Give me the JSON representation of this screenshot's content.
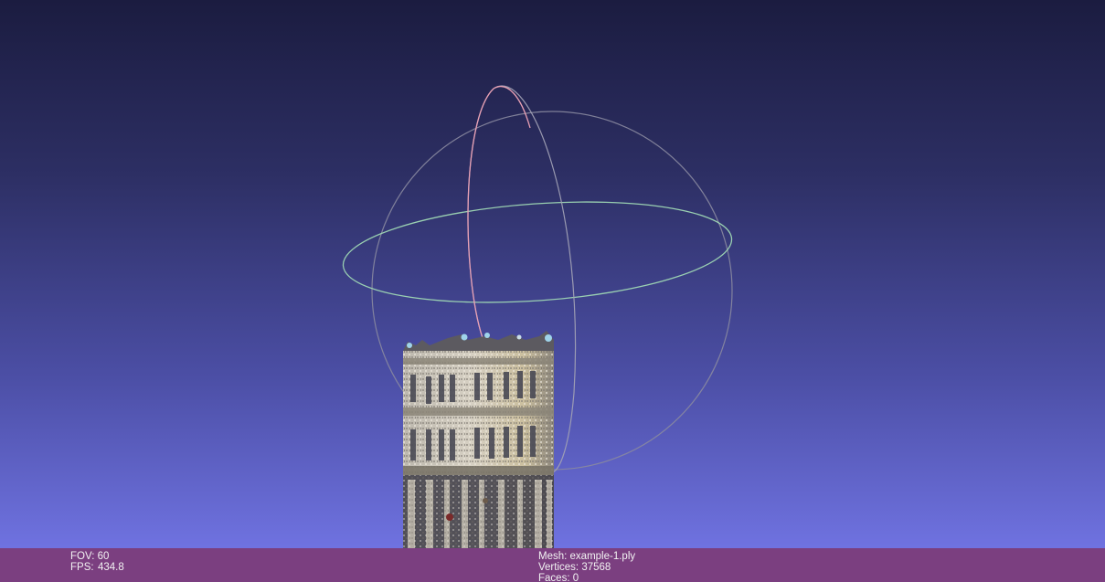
{
  "viewer": {
    "background_top": "#1b1c40",
    "background_bottom": "#7476e6",
    "trackball_colors": {
      "x_ring": "#e89aae",
      "y_ring": "#9ad6b0",
      "z_ring": "#8a8a9a"
    },
    "model": "point-cloud tower (colored)"
  },
  "status_bar": {
    "background": "#7b3f80",
    "fov_label": "FOV:",
    "fov_value": "60",
    "fps_label": "FPS:",
    "fps_value": "434.8",
    "mesh_label": "Mesh:",
    "mesh_value": "example-1.ply",
    "vertices_label": "Vertices:",
    "vertices_value": "37568",
    "faces_label": "Faces:",
    "faces_value": "0"
  }
}
